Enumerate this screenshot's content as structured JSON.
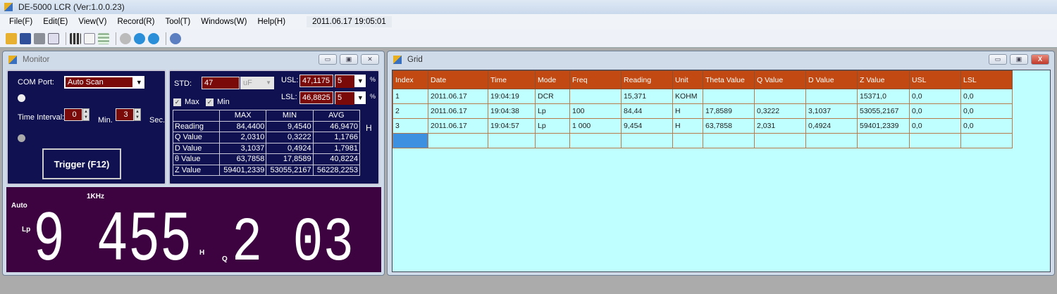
{
  "app": {
    "title": "DE-5000 LCR (Ver:1.0.0.23)"
  },
  "menu": {
    "items": [
      "File(F)",
      "Edit(E)",
      "View(V)",
      "Record(R)",
      "Tool(T)",
      "Windows(W)",
      "Help(H)"
    ],
    "clock": "2011.06.17 19:05:01"
  },
  "toolbar": {
    "icons": [
      "open-folder-icon",
      "save-icon",
      "print-icon",
      "print-preview-icon",
      "clapper-icon",
      "document-icon",
      "grid-icon",
      "play-icon",
      "pause-icon",
      "stop-icon",
      "help-icon"
    ]
  },
  "monitor": {
    "title": "Monitor",
    "com_label": "COM Port:",
    "com_value": "Auto Scan",
    "interval_label": "Time Interval:",
    "min_value": "0",
    "min_label": "Min.",
    "sec_value": "3",
    "sec_label": "Sec.",
    "trigger_label": "Trigger (F12)",
    "std_label": "STD:",
    "std_value": "47",
    "std_unit": "uF",
    "usl_label": "USL:",
    "usl_value": "47,1175",
    "usl_pct": "5",
    "lsl_label": "LSL:",
    "lsl_value": "46,8825",
    "lsl_pct": "5",
    "pct_sign": "%",
    "max_check": "Max",
    "min_check": "Min",
    "stats_headers": [
      "",
      "MAX",
      "MIN",
      "AVG"
    ],
    "stats_rows": [
      [
        "Reading",
        "84,4400",
        "9,4540",
        "46,9470"
      ],
      [
        "Q Value",
        "2,0310",
        "0,3222",
        "1,1766"
      ],
      [
        "D Value",
        "3,1037",
        "0,4924",
        "1,7981"
      ],
      [
        "θ Value",
        "63,7858",
        "17,8589",
        "40,8224"
      ],
      [
        "Z Value",
        "59401,2339",
        "53055,2167",
        "56228,2253"
      ]
    ],
    "stats_unit": "H",
    "display": {
      "freq": "1KHz",
      "range": "Auto",
      "mode": "Lp",
      "main": "9 455",
      "main_unit": "H",
      "sec_label": "Q",
      "secondary": "2 03"
    }
  },
  "grid": {
    "title": "Grid",
    "headers": [
      "Index",
      "Date",
      "Time",
      "Mode",
      "Freq",
      "Reading",
      "Unit",
      "Theta Value",
      "Q Value",
      "D Value",
      "Z Value",
      "USL",
      "LSL"
    ],
    "rows": [
      [
        "1",
        "2011.06.17",
        "19:04:19",
        "DCR",
        "",
        "15,371",
        "KOHM",
        "",
        "",
        "",
        "15371,0",
        "0,0",
        "0,0"
      ],
      [
        "2",
        "2011.06.17",
        "19:04:38",
        "Lp",
        "100",
        "84,44",
        "H",
        "17,8589",
        "0,3222",
        "3,1037",
        "53055,2167",
        "0,0",
        "0,0"
      ],
      [
        "3",
        "2011.06.17",
        "19:04:57",
        "Lp",
        "1 000",
        "9,454",
        "H",
        "63,7858",
        "2,031",
        "0,4924",
        "59401,2339",
        "0,0",
        "0,0"
      ],
      [
        "",
        "",
        "",
        "",
        "",
        "",
        "",
        "",
        "",
        "",
        "",
        "",
        ""
      ]
    ]
  },
  "colors": {
    "panel": "#0f1150",
    "display": "#3d0340",
    "grid_header": "#c24a12",
    "grid_bg": "#c0ffff",
    "input": "#7a0a0a"
  }
}
